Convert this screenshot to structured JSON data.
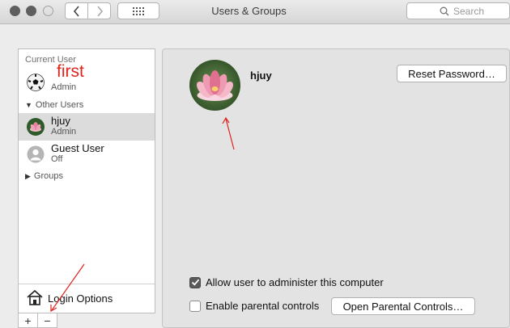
{
  "window": {
    "title": "Users & Groups",
    "search_placeholder": "Search"
  },
  "sidebar": {
    "current_user_label": "Current User",
    "current_user": {
      "name": "",
      "role": "Admin"
    },
    "other_users_label": "Other Users",
    "users": [
      {
        "name": "hjuy",
        "role": "Admin",
        "selected": true
      },
      {
        "name": "Guest User",
        "role": "Off",
        "selected": false
      }
    ],
    "groups_label": "Groups",
    "login_options_label": "Login Options",
    "add_label": "+",
    "remove_label": "−"
  },
  "annotation": {
    "text": "first",
    "color": "#e0231c"
  },
  "main": {
    "username": "hjuy",
    "reset_password_label": "Reset Password…",
    "allow_admin_label": "Allow user to administer this computer",
    "allow_admin_checked": true,
    "parental_controls_label": "Enable parental controls",
    "parental_controls_checked": false,
    "open_parental_label": "Open Parental Controls…"
  },
  "icons": {
    "nav_back": "chevron-left-icon",
    "nav_forward": "chevron-right-icon",
    "grid": "grid-icon",
    "search": "search-icon",
    "home": "house-icon"
  }
}
